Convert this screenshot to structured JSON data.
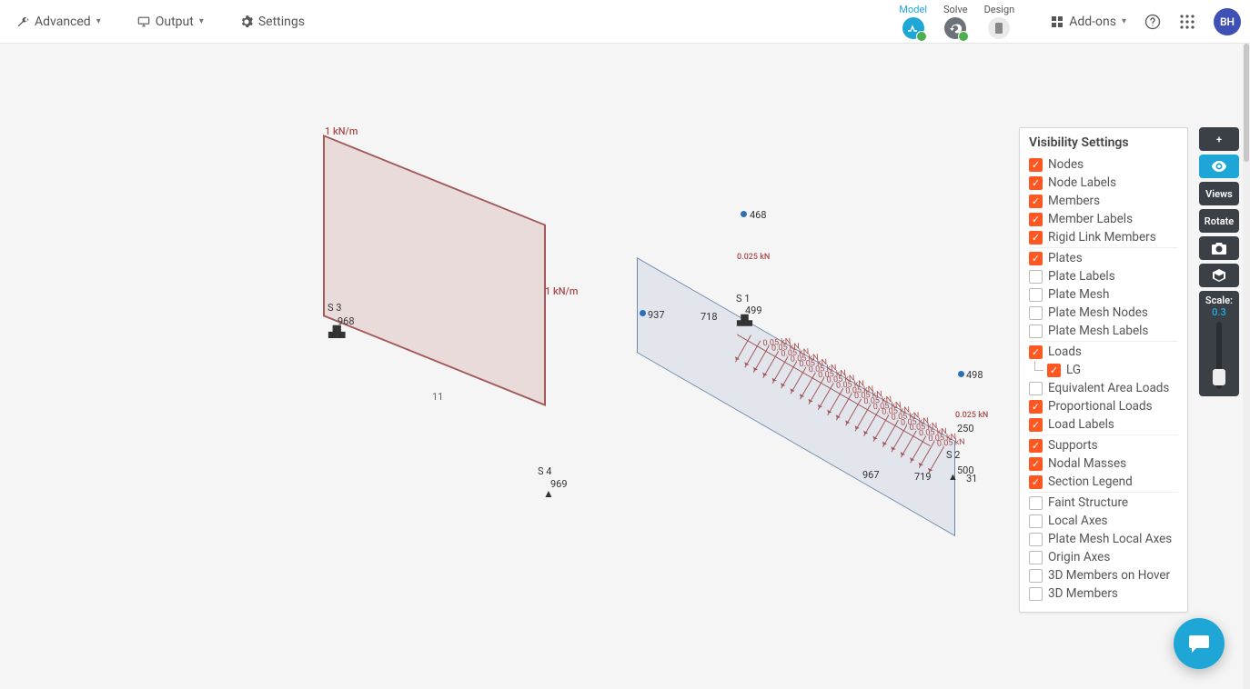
{
  "toolbar": {
    "advanced_label": "Advanced",
    "output_label": "Output",
    "settings_label": "Settings",
    "addons_label": "Add-ons",
    "avatar_initials": "BH"
  },
  "stages": {
    "model": "Model",
    "solve": "Solve",
    "design": "Design"
  },
  "side_tools": {
    "plus": "+",
    "views": "Views",
    "rotate": "Rotate",
    "scale_title": "Scale:",
    "scale_value": "0.3"
  },
  "visibility": {
    "title": "Visibility Settings",
    "items": [
      {
        "label": "Nodes",
        "checked": true
      },
      {
        "label": "Node Labels",
        "checked": true
      },
      {
        "label": "Members",
        "checked": true
      },
      {
        "label": "Member Labels",
        "checked": true
      },
      {
        "label": "Rigid Link Members",
        "checked": true,
        "sep": true
      },
      {
        "label": "Plates",
        "checked": true
      },
      {
        "label": "Plate Labels",
        "checked": false
      },
      {
        "label": "Plate Mesh",
        "checked": false
      },
      {
        "label": "Plate Mesh Nodes",
        "checked": false
      },
      {
        "label": "Plate Mesh Labels",
        "checked": false,
        "sep": true
      },
      {
        "label": "Loads",
        "checked": true
      },
      {
        "label": "LG",
        "checked": true,
        "sub": true
      },
      {
        "label": "Equivalent Area Loads",
        "checked": false
      },
      {
        "label": "Proportional Loads",
        "checked": true
      },
      {
        "label": "Load Labels",
        "checked": true,
        "sep": true
      },
      {
        "label": "Supports",
        "checked": true
      },
      {
        "label": "Nodal Masses",
        "checked": true
      },
      {
        "label": "Section Legend",
        "checked": true,
        "sep": true
      },
      {
        "label": "Faint Structure",
        "checked": false
      },
      {
        "label": "Local Axes",
        "checked": false
      },
      {
        "label": "Plate Mesh Local Axes",
        "checked": false
      },
      {
        "label": "Origin Axes",
        "checked": false
      },
      {
        "label": "3D Members on Hover",
        "checked": false
      },
      {
        "label": "3D Members",
        "checked": false
      }
    ]
  },
  "model_left": {
    "load_top": "1 kN/m",
    "load_right": "1 kN/m",
    "support_top": "S 3",
    "support_bottom": "S 4",
    "node_top": "968",
    "node_bottom": "969",
    "member_label": "11"
  },
  "model_right": {
    "nodes": {
      "n468": "468",
      "n498": "498",
      "n937": "937",
      "n718": "718",
      "n499": "499",
      "n967": "967",
      "n719": "719",
      "n500": "500",
      "n250": "250",
      "n31": "31"
    },
    "support_top": "S 1",
    "support_bottom": "S 2",
    "load_end_top": "0.025 kN",
    "load_end_bottom": "0.025 kN",
    "load_repeat": "0.05 kN"
  }
}
